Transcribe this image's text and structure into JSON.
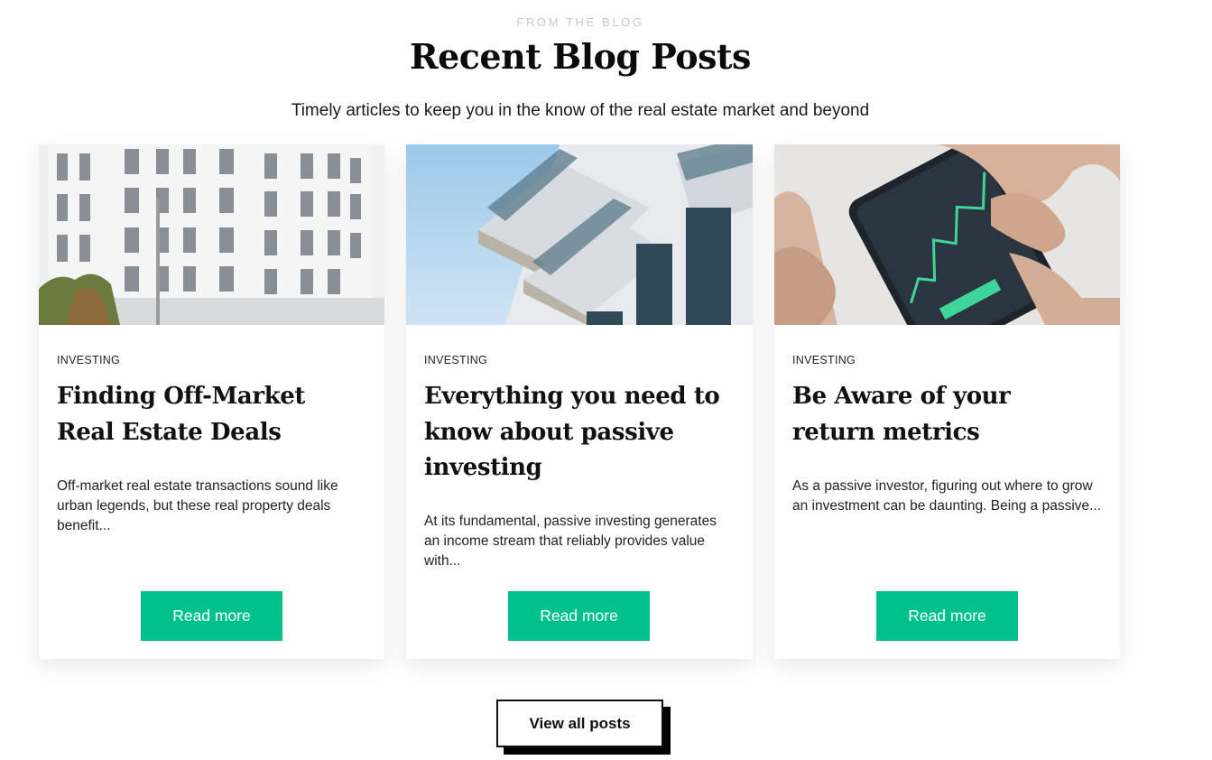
{
  "header": {
    "eyebrow": "FROM THE BLOG",
    "title": "Recent Blog Posts",
    "subtitle": "Timely articles to keep you in the know of the real estate market and beyond"
  },
  "posts": [
    {
      "category": "INVESTING",
      "title": "Finding Off-Market Real Estate Deals",
      "excerpt": "Off-market real estate transactions sound like urban legends, but these real property deals benefit...",
      "button_label": "Read more",
      "image": "white-apartment-building-photo"
    },
    {
      "category": "INVESTING",
      "title": "Everything you need to know about passive investing",
      "excerpt": "At its fundamental, passive investing generates an income stream that reliably provides value with...",
      "button_label": "Read more",
      "image": "glass-balcony-building-photo"
    },
    {
      "category": "INVESTING",
      "title": "Be Aware of your return metrics",
      "excerpt": "As a passive investor, figuring out where to grow an investment can be daunting. Being a passive...",
      "button_label": "Read more",
      "image": "hands-holding-phone-chart-photo"
    }
  ],
  "footer": {
    "view_all_label": "View all posts"
  },
  "colors": {
    "accent": "#00c08b",
    "text": "#111111",
    "eyebrow": "#c9c9c9"
  }
}
